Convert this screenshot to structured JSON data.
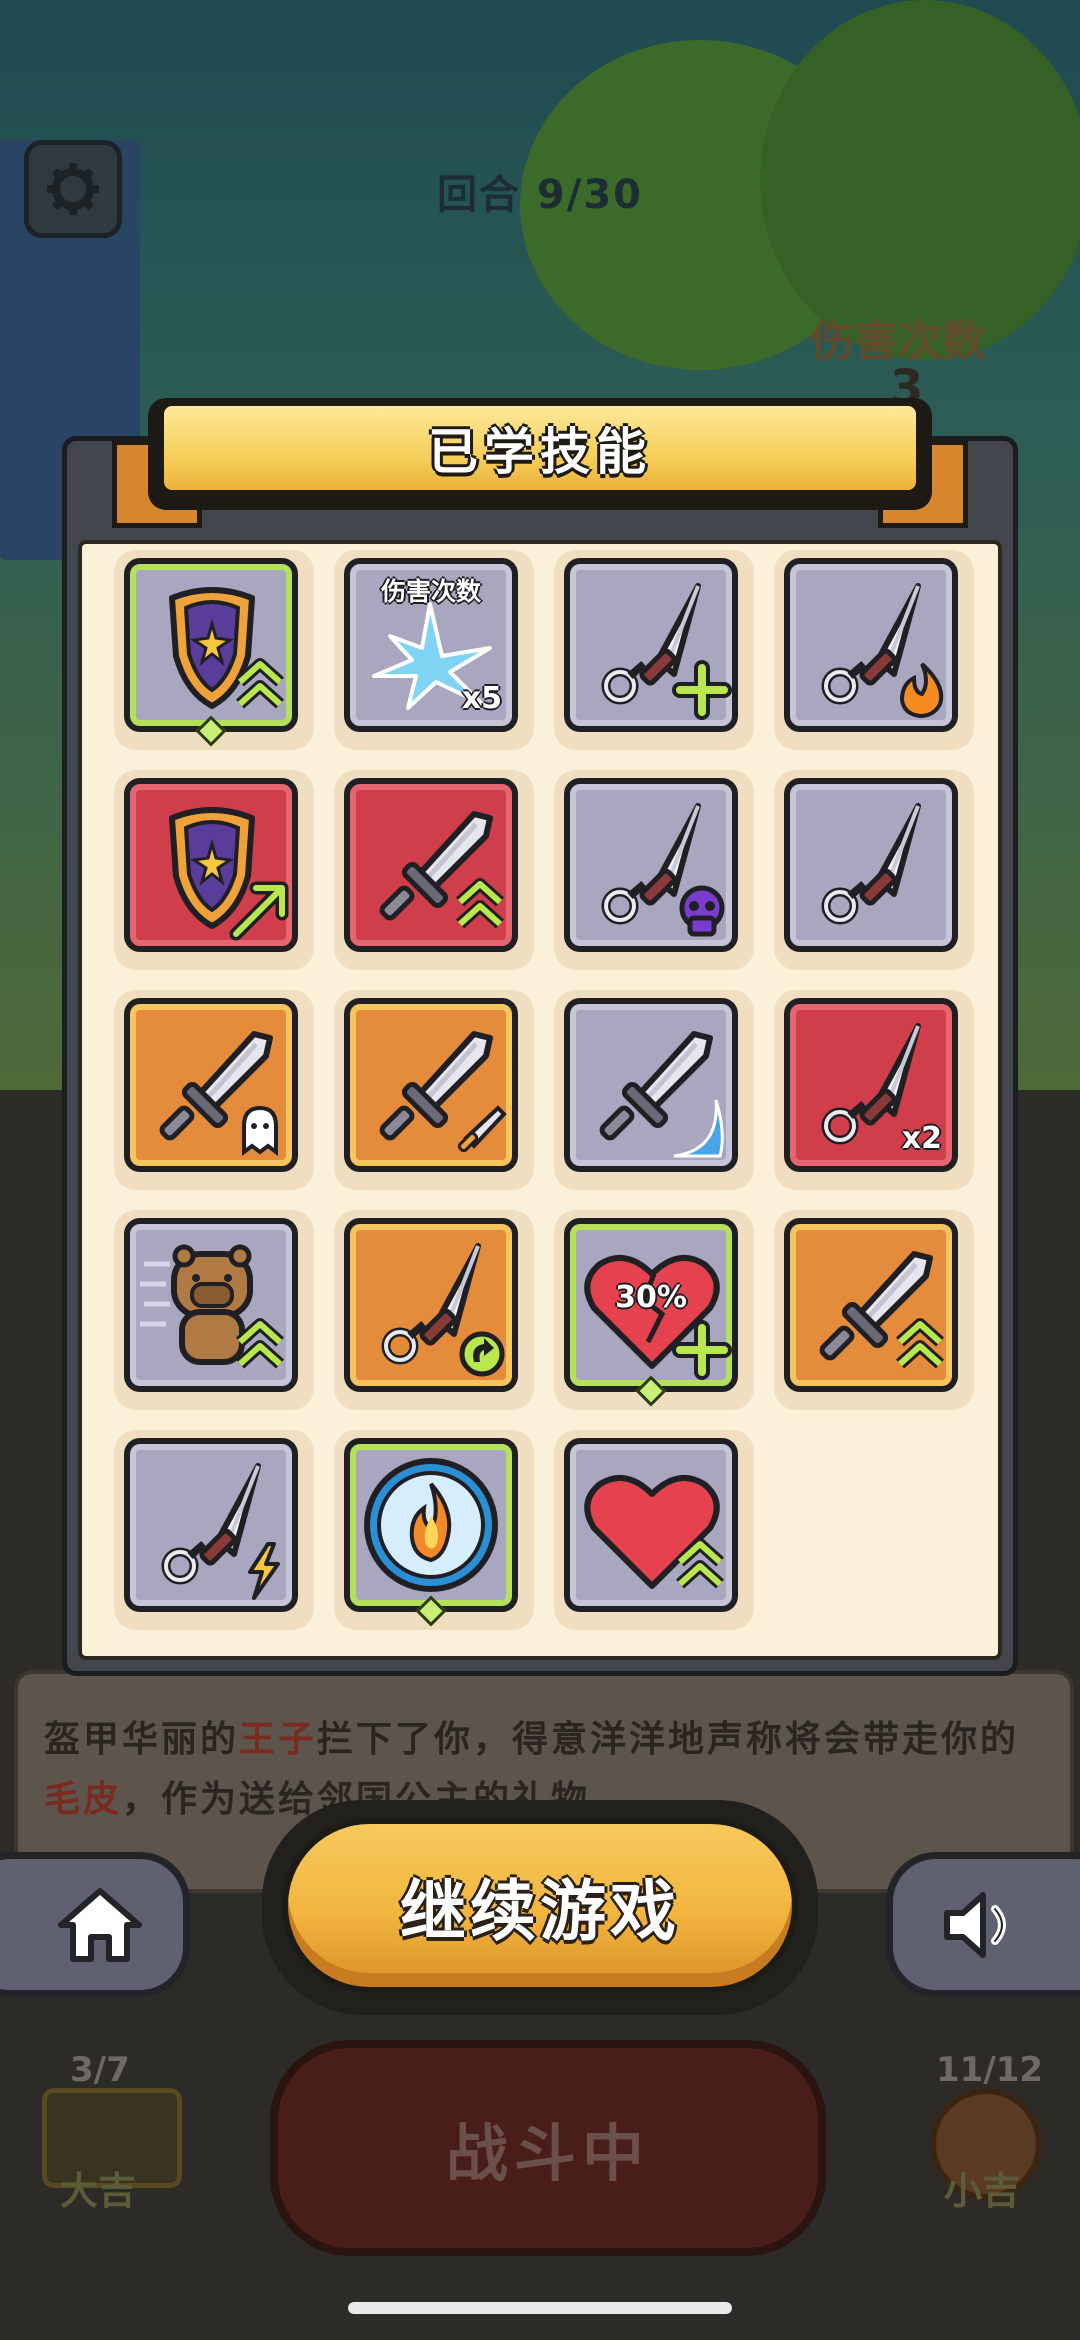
{
  "hud": {
    "round_text": "回合 9/30",
    "damage_label": "伤害次数",
    "damage_value": "3"
  },
  "modal": {
    "title": "已学技能",
    "skills": [
      {
        "id": "shield-upgrade",
        "frame": "gray",
        "border": "green",
        "icon": "shield-icon",
        "badge": "double-chevron-up-icon"
      },
      {
        "id": "damage-count-x5",
        "frame": "gray",
        "icon": "ice-spike-icon",
        "label": "伤害次数",
        "multiplier": "x5"
      },
      {
        "id": "kunai-plus",
        "frame": "gray",
        "icon": "kunai-icon",
        "badge": "plus-icon"
      },
      {
        "id": "kunai-fire",
        "frame": "gray",
        "icon": "kunai-icon",
        "badge": "flame-icon"
      },
      {
        "id": "shield-boost",
        "frame": "red",
        "icon": "shield-icon",
        "badge": "arrow-up-right-icon"
      },
      {
        "id": "sword-upgrade",
        "frame": "red",
        "icon": "sword-icon",
        "badge": "double-chevron-up-icon"
      },
      {
        "id": "kunai-poison",
        "frame": "gray",
        "icon": "kunai-icon",
        "badge": "skull-icon"
      },
      {
        "id": "kunai-basic",
        "frame": "gray",
        "icon": "kunai-icon"
      },
      {
        "id": "sword-ghost",
        "frame": "orange",
        "icon": "sword-icon",
        "badge": "ghost-icon"
      },
      {
        "id": "sword-split",
        "frame": "orange",
        "icon": "sword-icon",
        "badge": "mini-sword-icon"
      },
      {
        "id": "sword-wave",
        "frame": "gray",
        "icon": "sword-icon",
        "badge": "wave-icon"
      },
      {
        "id": "kunai-x2",
        "frame": "red",
        "icon": "kunai-icon",
        "multiplier": "x2"
      },
      {
        "id": "capybara-speed",
        "frame": "gray",
        "icon": "capybara-icon",
        "badge": "double-chevron-up-icon"
      },
      {
        "id": "kunai-return",
        "frame": "orange",
        "icon": "kunai-icon",
        "badge": "return-icon"
      },
      {
        "id": "heal-30",
        "frame": "gray",
        "border": "green",
        "icon": "broken-heart-icon",
        "label": "30%",
        "badge": "plus-icon"
      },
      {
        "id": "sword-crit",
        "frame": "orange",
        "icon": "sword-icon",
        "badge": "double-chevron-up-icon"
      },
      {
        "id": "kunai-lightning",
        "frame": "gray",
        "icon": "kunai-icon",
        "badge": "lightning-icon"
      },
      {
        "id": "fire-orb",
        "frame": "gray",
        "border": "green",
        "icon": "fire-orb-icon"
      },
      {
        "id": "heart-regen",
        "frame": "gray",
        "icon": "heart-icon",
        "badge": "double-chevron-up-icon"
      }
    ]
  },
  "story": {
    "part1": "盔甲华丽的",
    "highlight1": "王子",
    "part2": "拦下了你，得意洋洋地声称将会带走你的",
    "highlight2": "毛皮",
    "part3": "，作为送给邻国公主的礼物。"
  },
  "buttons": {
    "continue": "继续游戏",
    "battle": "战斗中"
  },
  "luck": {
    "left_counter": "3/7",
    "left_label": "大吉",
    "right_counter": "11/12",
    "right_label": "小吉"
  },
  "colors": {
    "banner": "#f6cf5a",
    "paper": "#fbf0d8",
    "gray_card": "#a8a7bf",
    "red_card": "#cf3e4a",
    "orange_card": "#e48c3c",
    "continue_button": "#f2b53f"
  }
}
